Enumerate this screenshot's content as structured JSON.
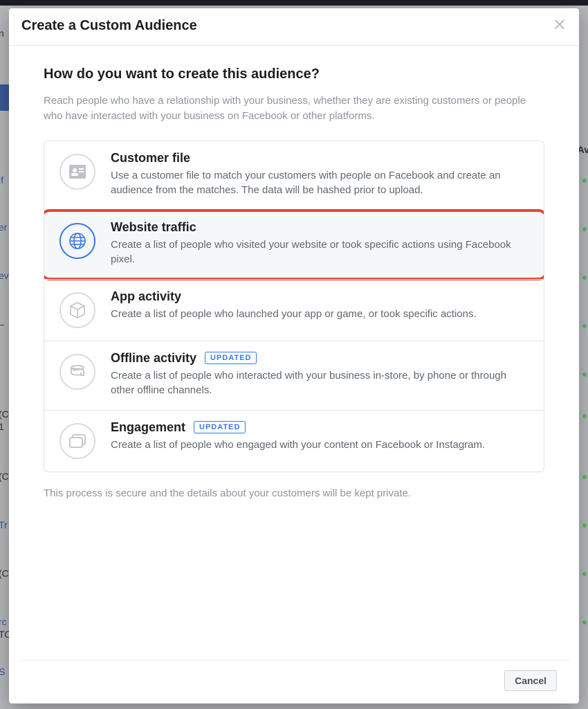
{
  "modal": {
    "title": "Create a Custom Audience",
    "subtitle": "How do you want to create this audience?",
    "lead": "Reach people who have a relationship with your business, whether they are existing customers or people who have interacted with your business on Facebook or other platforms.",
    "footnote": "This process is secure and the details about your customers will be kept private.",
    "cancel": "Cancel"
  },
  "options": {
    "customer_file": {
      "title": "Customer file",
      "desc": "Use a customer file to match your customers with people on Facebook and create an audience from the matches. The data will be hashed prior to upload."
    },
    "website_traffic": {
      "title": "Website traffic",
      "desc": "Create a list of people who visited your website or took specific actions using Facebook pixel."
    },
    "app_activity": {
      "title": "App activity",
      "desc": "Create a list of people who launched your app or game, or took specific actions."
    },
    "offline_activity": {
      "title": "Offline activity",
      "badge": "UPDATED",
      "desc": "Create a list of people who interacted with your business in-store, by phone or through other offline channels."
    },
    "engagement": {
      "title": "Engagement",
      "badge": "UPDATED",
      "desc": "Create a list of people who engaged with your content on Facebook or Instagram."
    }
  },
  "bg": {
    "n": "n",
    "if": "if",
    "er": "er",
    "ev": "ev",
    "dash": "–",
    "c1": "(C",
    "one": "1",
    "c2": "(C",
    "tr": "Tr",
    "c3": "(C",
    "rc": "rc",
    "to": "TO",
    "s": "S",
    "av": "Av"
  }
}
